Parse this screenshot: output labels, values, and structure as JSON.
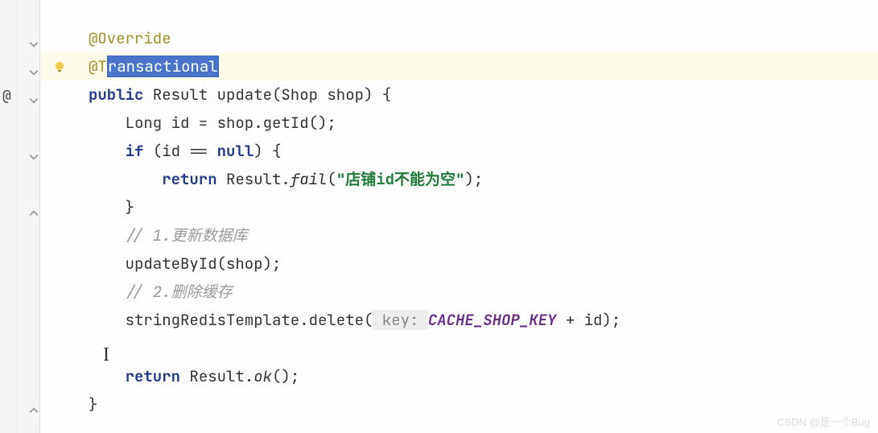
{
  "gutter": {
    "at_sign": "@"
  },
  "code": {
    "line1": {
      "annotation": "@Override"
    },
    "line2": {
      "prefix": "@T",
      "selected": "ransactional"
    },
    "line3": {
      "kw1": "public",
      "text1": " Result update(Shop shop) {"
    },
    "line4": {
      "text1": "    Long id = shop.getId();"
    },
    "line5": {
      "kw1": "if",
      "text1": " (id == ",
      "kw2": "null",
      "text2": ") {"
    },
    "line6": {
      "kw1": "return",
      "text1": " Result.",
      "method": "fail",
      "text2": "(",
      "string": "\"店铺id不能为空\"",
      "text3": ");"
    },
    "line7": {
      "text1": "    }"
    },
    "line8": {
      "comment": "// 1.更新数据库"
    },
    "line9": {
      "text1": "    updateById(shop);"
    },
    "line10": {
      "comment": "// 2.删除缓存"
    },
    "line11": {
      "text1": "    stringRedisTemplate.delete(",
      "hint": " key: ",
      "const": "CACHE_SHOP_KEY",
      "text2": " + id);"
    },
    "line13": {
      "kw1": "return",
      "text1": " Result.",
      "method": "ok",
      "text2": "();"
    },
    "line14": {
      "text1": "}"
    }
  },
  "watermark": "CSDN @是一个Bug"
}
